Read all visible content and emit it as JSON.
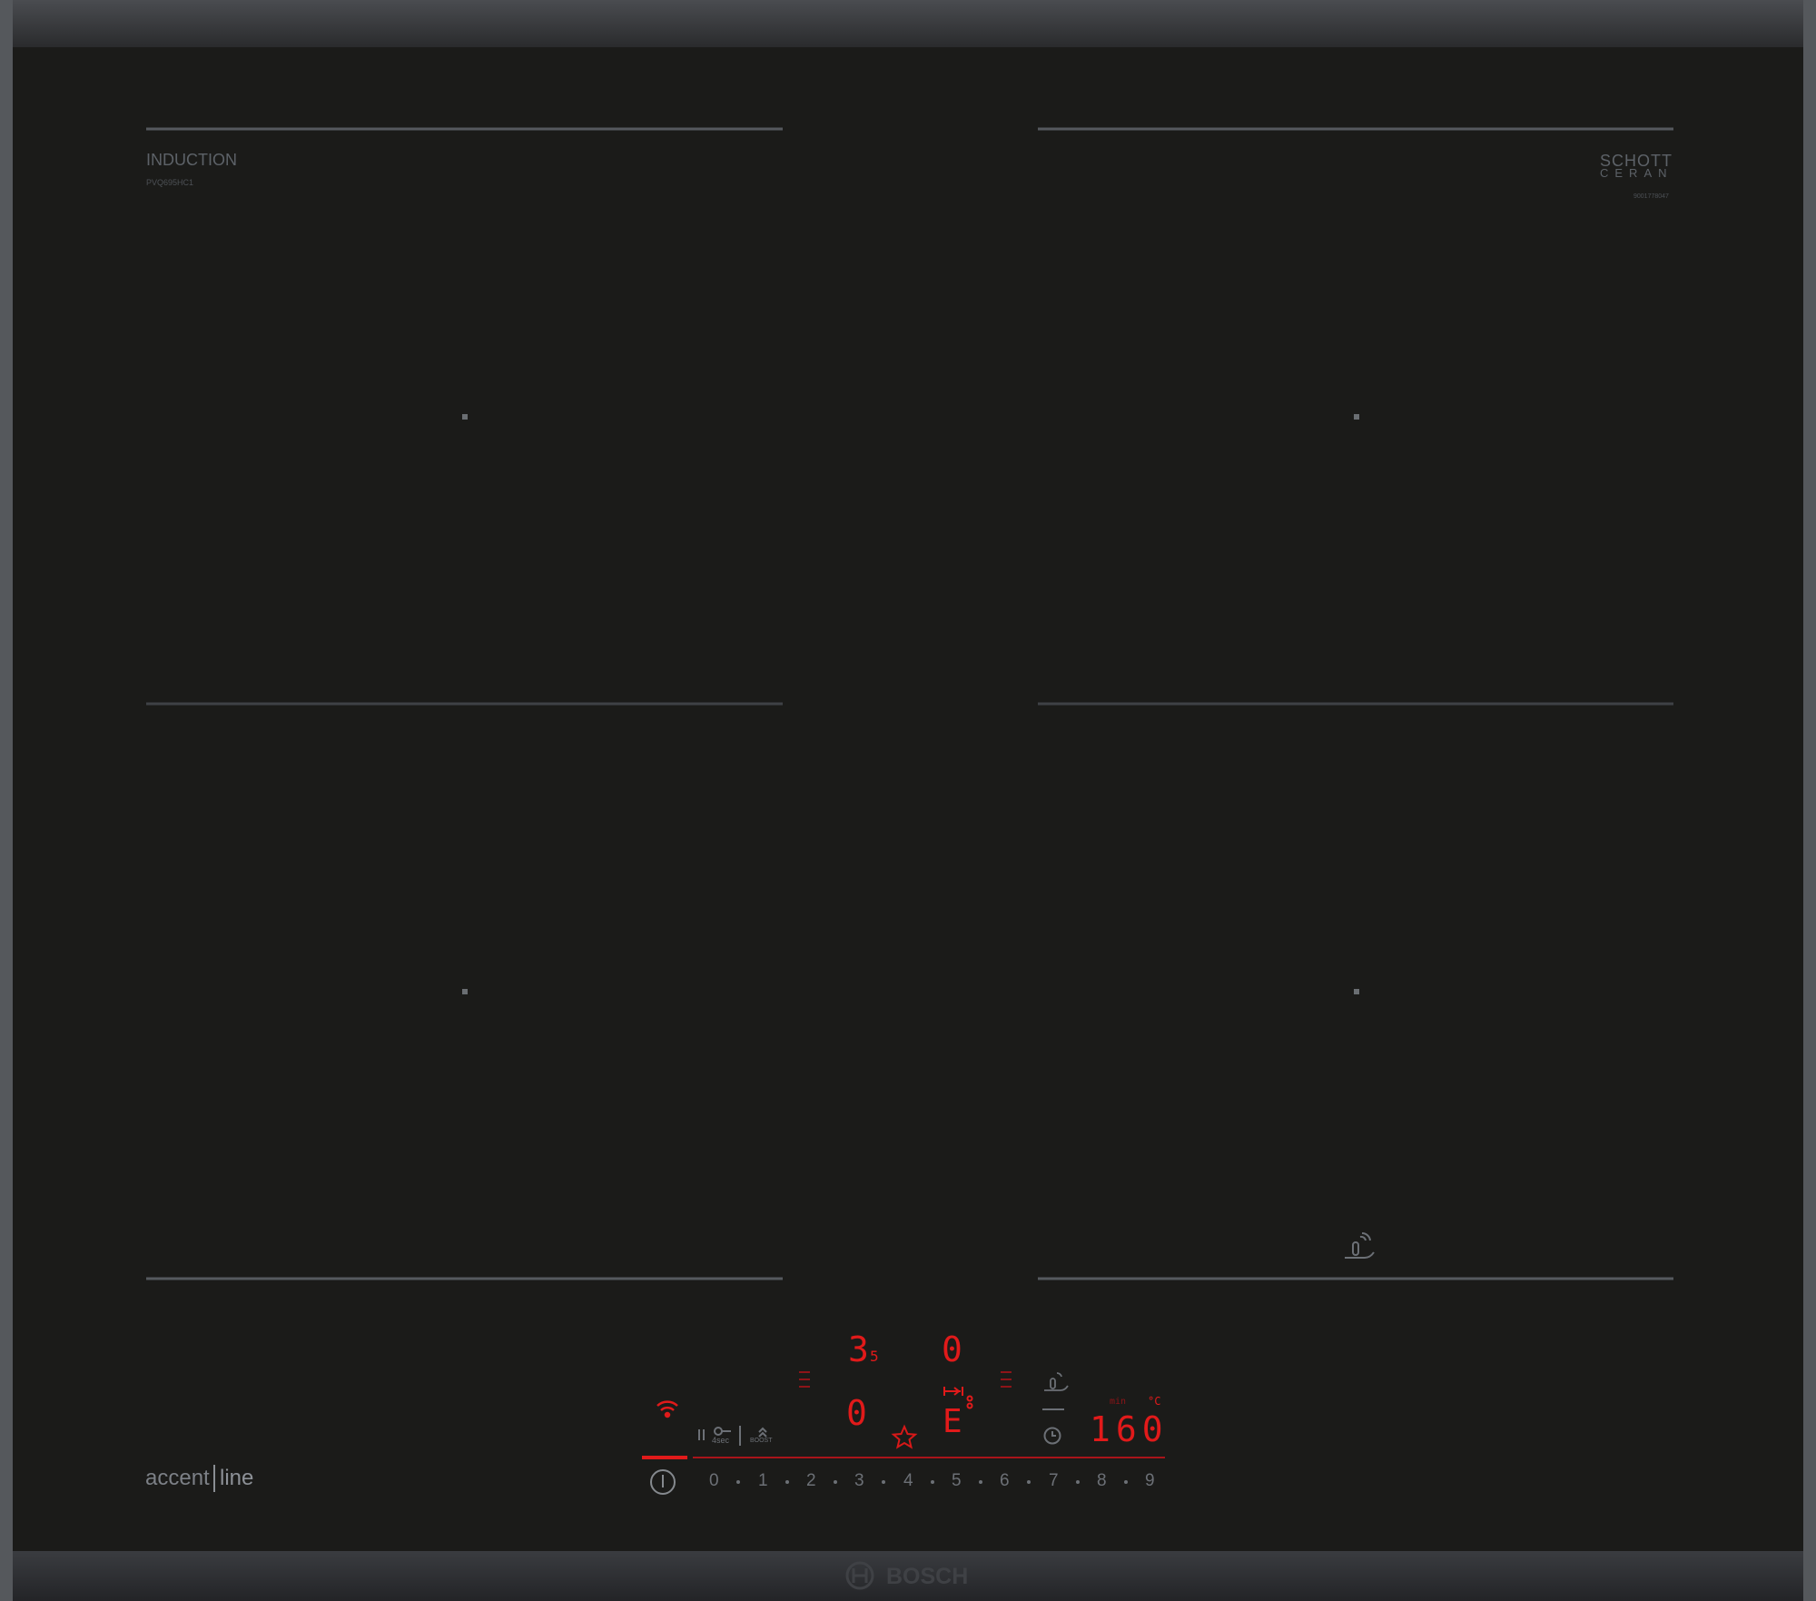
{
  "brand": {
    "type_label": "INDUCTION",
    "model": "PVQ695HC1",
    "glass_brand_line1": "SCHOTT",
    "glass_brand_line2": "CERAN",
    "glass_code": "9001778047",
    "series_left": "accent",
    "series_right": "line",
    "logo": "BOSCH"
  },
  "colors": {
    "glass": "#1b1b19",
    "frame": "#2b2c2e",
    "frame_edge": "#55585c",
    "marking": "#55595e",
    "display_red": "#e11a1a"
  },
  "display": {
    "zone_top_left_level": "3",
    "zone_top_left_sub": "5",
    "zone_top_right_level": "0",
    "zone_bottom_left_level": "0",
    "zone_bottom_right_level": "E",
    "timer_unit": "min",
    "temp_unit": "°C",
    "temperature": "160",
    "lock_duration": "4sec",
    "boost_label": "BOOST"
  },
  "slider": {
    "power_icon": "power-icon",
    "levels": [
      "0",
      "1",
      "2",
      "3",
      "4",
      "5",
      "6",
      "7",
      "8",
      "9"
    ]
  },
  "icons": [
    "wifi-icon",
    "pause-icon",
    "key-lock-icon",
    "boost-icon",
    "star-icon",
    "timer-icon",
    "pan-sensor-icon",
    "flex-link-icon"
  ]
}
